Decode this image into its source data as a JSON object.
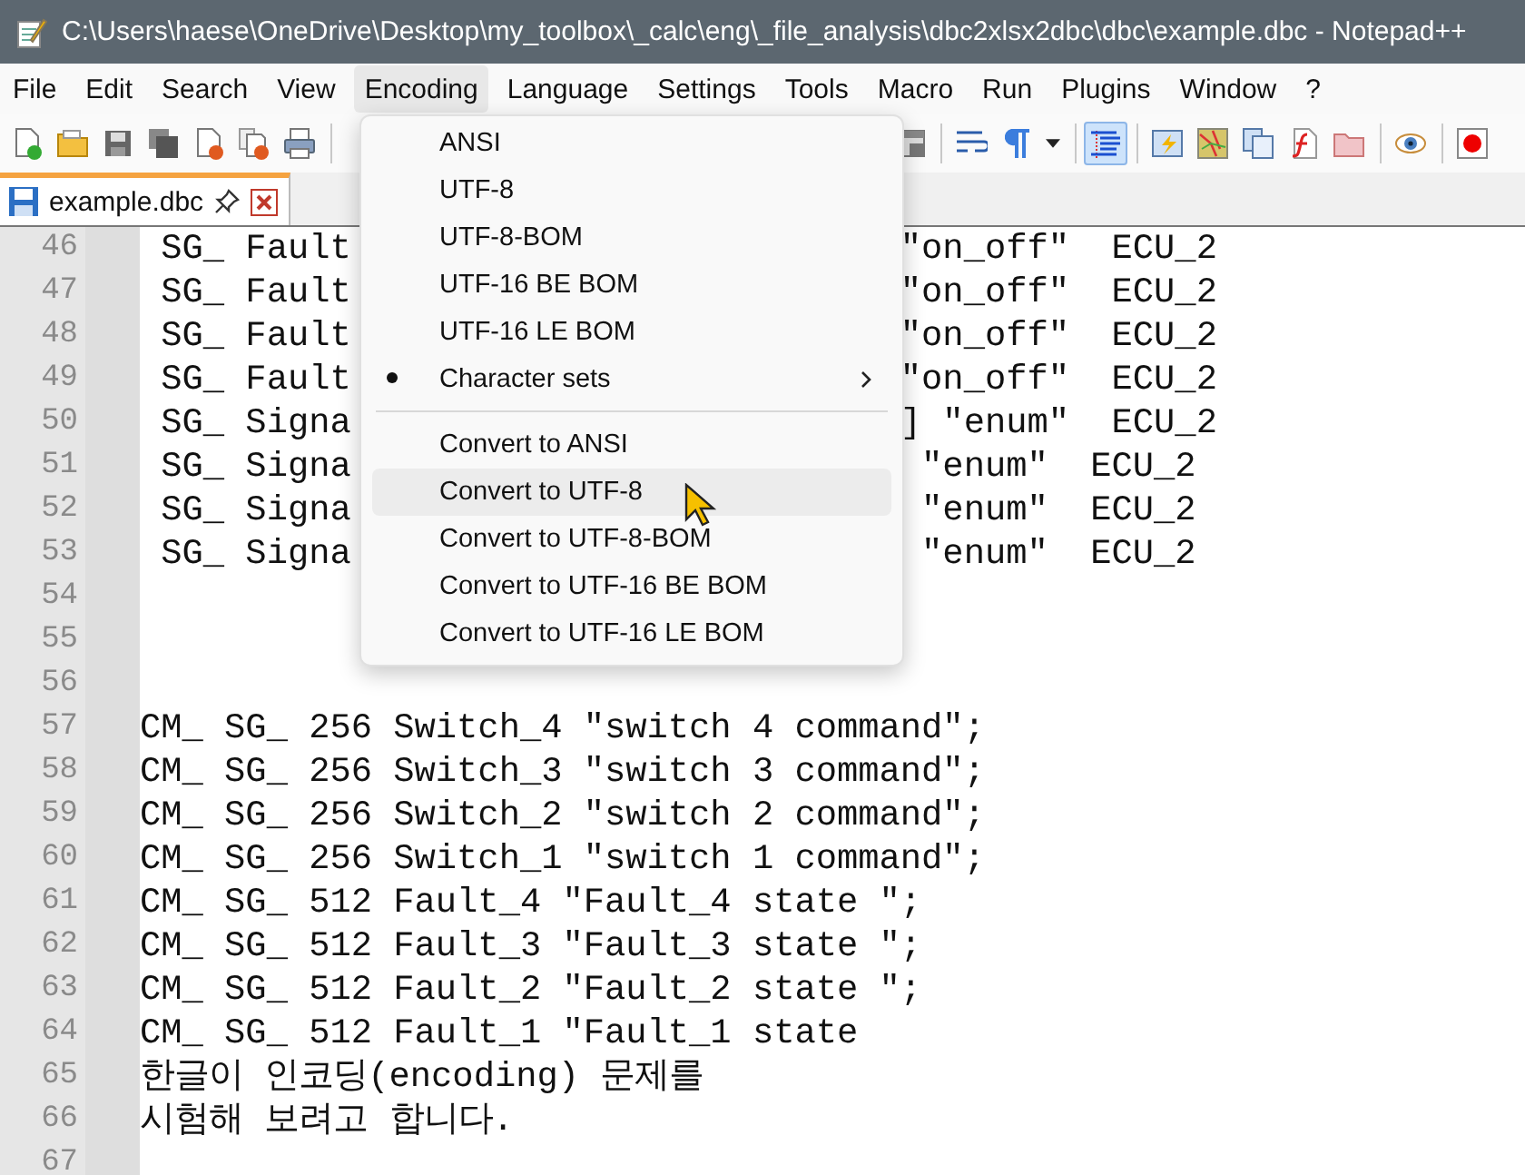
{
  "window": {
    "title": "C:\\Users\\haese\\OneDrive\\Desktop\\my_toolbox\\_calc\\eng\\_file_analysis\\dbc2xlsx2dbc\\dbc\\example.dbc - Notepad++"
  },
  "menu_bar": [
    {
      "label": "File",
      "selected": false
    },
    {
      "label": "Edit",
      "selected": false
    },
    {
      "label": "Search",
      "selected": false
    },
    {
      "label": "View",
      "selected": false
    },
    {
      "label": "Encoding",
      "selected": true
    },
    {
      "label": "Language",
      "selected": false
    },
    {
      "label": "Settings",
      "selected": false
    },
    {
      "label": "Tools",
      "selected": false
    },
    {
      "label": "Macro",
      "selected": false
    },
    {
      "label": "Run",
      "selected": false
    },
    {
      "label": "Plugins",
      "selected": false
    },
    {
      "label": "Window",
      "selected": false
    },
    {
      "label": "?",
      "selected": false
    }
  ],
  "toolbar_buttons": [
    {
      "selected": false
    },
    {
      "selected": false
    },
    {
      "selected": false
    },
    {
      "selected": false
    },
    {
      "selected": false
    },
    {
      "selected": false
    },
    {
      "selected": false
    },
    {
      "selected": false
    },
    {
      "selected": false
    },
    {
      "selected": false
    },
    {
      "selected": false
    },
    {
      "selected": true
    },
    {
      "selected": false
    },
    {
      "selected": false
    },
    {
      "selected": false
    },
    {
      "selected": false
    },
    {
      "selected": false
    },
    {
      "selected": false
    },
    {
      "selected": false
    }
  ],
  "tabs": [
    {
      "label": "example.dbc",
      "selected": true
    }
  ],
  "editor": {
    "lines": [
      {
        "number": "46",
        "text": " SG_ Fault",
        "text_right": "\"on_off\"  ECU_2"
      },
      {
        "number": "47",
        "text": " SG_ Fault",
        "text_right": "\"on_off\"  ECU_2"
      },
      {
        "number": "48",
        "text": " SG_ Fault",
        "text_right": "\"on_off\"  ECU_2"
      },
      {
        "number": "49",
        "text": " SG_ Fault",
        "text_right": "\"on_off\"  ECU_2"
      },
      {
        "number": "50",
        "text": " SG_ Signa",
        "text_right": "] \"enum\"  ECU_2"
      },
      {
        "number": "51",
        "text": " SG_ Signa",
        "text_right": " \"enum\"  ECU_2"
      },
      {
        "number": "52",
        "text": " SG_ Signa",
        "text_right": " \"enum\"  ECU_2"
      },
      {
        "number": "53",
        "text": " SG_ Signa",
        "text_right": " \"enum\"  ECU_2"
      },
      {
        "number": "54"
      },
      {
        "number": "55"
      },
      {
        "number": "56"
      },
      {
        "number": "57",
        "text": "CM_ SG_ 256 Switch_4 \"switch 4 command\";"
      },
      {
        "number": "58",
        "text": "CM_ SG_ 256 Switch_3 \"switch 3 command\";"
      },
      {
        "number": "59",
        "text": "CM_ SG_ 256 Switch_2 \"switch 2 command\";"
      },
      {
        "number": "60",
        "text": "CM_ SG_ 256 Switch_1 \"switch 1 command\";"
      },
      {
        "number": "61",
        "text": "CM_ SG_ 512 Fault_4 \"Fault_4 state \";"
      },
      {
        "number": "62",
        "text": "CM_ SG_ 512 Fault_3 \"Fault_3 state \";"
      },
      {
        "number": "63",
        "text": "CM_ SG_ 512 Fault_2 \"Fault_2 state \";"
      },
      {
        "number": "64",
        "text": "CM_ SG_ 512 Fault_1 \"Fault_1 state"
      },
      {
        "number": "65",
        "text": "한글이 인코딩(encoding) 문제를"
      },
      {
        "number": "66",
        "text": "시험해 보려고 합니다."
      },
      {
        "number": "67"
      }
    ]
  },
  "encoding_menu": {
    "items": [
      {
        "kind": "item",
        "label": "ANSI",
        "checked": false,
        "selected": false
      },
      {
        "kind": "item",
        "label": "UTF-8",
        "checked": false,
        "selected": false
      },
      {
        "kind": "item",
        "label": "UTF-8-BOM",
        "checked": false,
        "selected": false
      },
      {
        "kind": "item",
        "label": "UTF-16 BE BOM",
        "checked": false,
        "selected": false
      },
      {
        "kind": "item",
        "label": "UTF-16 LE BOM",
        "checked": false,
        "selected": false
      },
      {
        "kind": "submenu",
        "label": "Character sets",
        "checked": true,
        "selected": false
      },
      {
        "kind": "separator"
      },
      {
        "kind": "item",
        "label": "Convert to ANSI",
        "checked": false,
        "selected": false
      },
      {
        "kind": "item",
        "label": "Convert to UTF-8",
        "checked": false,
        "selected": true
      },
      {
        "kind": "item",
        "label": "Convert to UTF-8-BOM",
        "checked": false,
        "selected": false
      },
      {
        "kind": "item",
        "label": "Convert to UTF-16 BE BOM",
        "checked": false,
        "selected": false
      },
      {
        "kind": "item",
        "label": "Convert to UTF-16 LE BOM",
        "checked": false,
        "selected": false
      }
    ]
  }
}
